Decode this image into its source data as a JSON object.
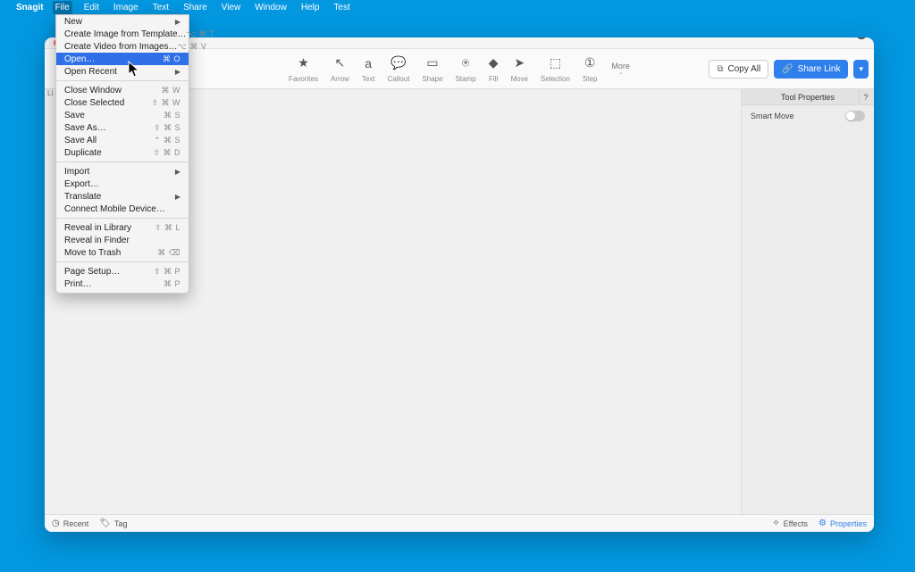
{
  "menubar": {
    "app_name": "Snagit",
    "items": [
      "File",
      "Edit",
      "Image",
      "Text",
      "Share",
      "View",
      "Window",
      "Help",
      "Test"
    ],
    "active_index": 0
  },
  "dropdown": {
    "groups": [
      [
        {
          "label": "New",
          "shortcut": "",
          "submenu": true
        },
        {
          "label": "Create Image from Template…",
          "shortcut": "⌥ ⌘ T"
        },
        {
          "label": "Create Video from Images…",
          "shortcut": "⌥ ⌘ V"
        },
        {
          "label": "Open…",
          "shortcut": "⌘ O",
          "highlighted": true
        },
        {
          "label": "Open Recent",
          "shortcut": "",
          "submenu": true
        }
      ],
      [
        {
          "label": "Close Window",
          "shortcut": "⌘ W"
        },
        {
          "label": "Close Selected",
          "shortcut": "⇧ ⌘ W"
        },
        {
          "label": "Save",
          "shortcut": "⌘ S"
        },
        {
          "label": "Save As…",
          "shortcut": "⇧ ⌘ S"
        },
        {
          "label": "Save All",
          "shortcut": "⌃ ⌘ S"
        },
        {
          "label": "Duplicate",
          "shortcut": "⇧ ⌘ D"
        }
      ],
      [
        {
          "label": "Import",
          "shortcut": "",
          "submenu": true
        },
        {
          "label": "Export…",
          "shortcut": ""
        },
        {
          "label": "Translate",
          "shortcut": "",
          "submenu": true
        },
        {
          "label": "Connect Mobile Device…",
          "shortcut": ""
        }
      ],
      [
        {
          "label": "Reveal in Library",
          "shortcut": "⇧ ⌘ L"
        },
        {
          "label": "Reveal in Finder",
          "shortcut": ""
        },
        {
          "label": "Move to Trash",
          "shortcut": "⌘ ⌫"
        }
      ],
      [
        {
          "label": "Page Setup…",
          "shortcut": "⇧ ⌘ P"
        },
        {
          "label": "Print…",
          "shortcut": "⌘ P"
        }
      ]
    ]
  },
  "left_rail": "Li",
  "toolbar": {
    "tools": [
      {
        "label": "Favorites",
        "icon": "★"
      },
      {
        "label": "Arrow",
        "icon": "↖"
      },
      {
        "label": "Text",
        "icon": "a"
      },
      {
        "label": "Callout",
        "icon": "💬"
      },
      {
        "label": "Shape",
        "icon": "▭"
      },
      {
        "label": "Stamp",
        "icon": "⍟"
      },
      {
        "label": "Fill",
        "icon": "◆"
      },
      {
        "label": "Move",
        "icon": "➤"
      },
      {
        "label": "Selection",
        "icon": "⬚"
      },
      {
        "label": "Step",
        "icon": "①"
      }
    ],
    "more": "More",
    "copy_all": "Copy All",
    "share": "Share Link"
  },
  "right_panel": {
    "title": "Tool Properties",
    "smart_move": "Smart Move"
  },
  "bottom": {
    "recent": "Recent",
    "tag": "Tag",
    "effects": "Effects",
    "properties": "Properties"
  }
}
